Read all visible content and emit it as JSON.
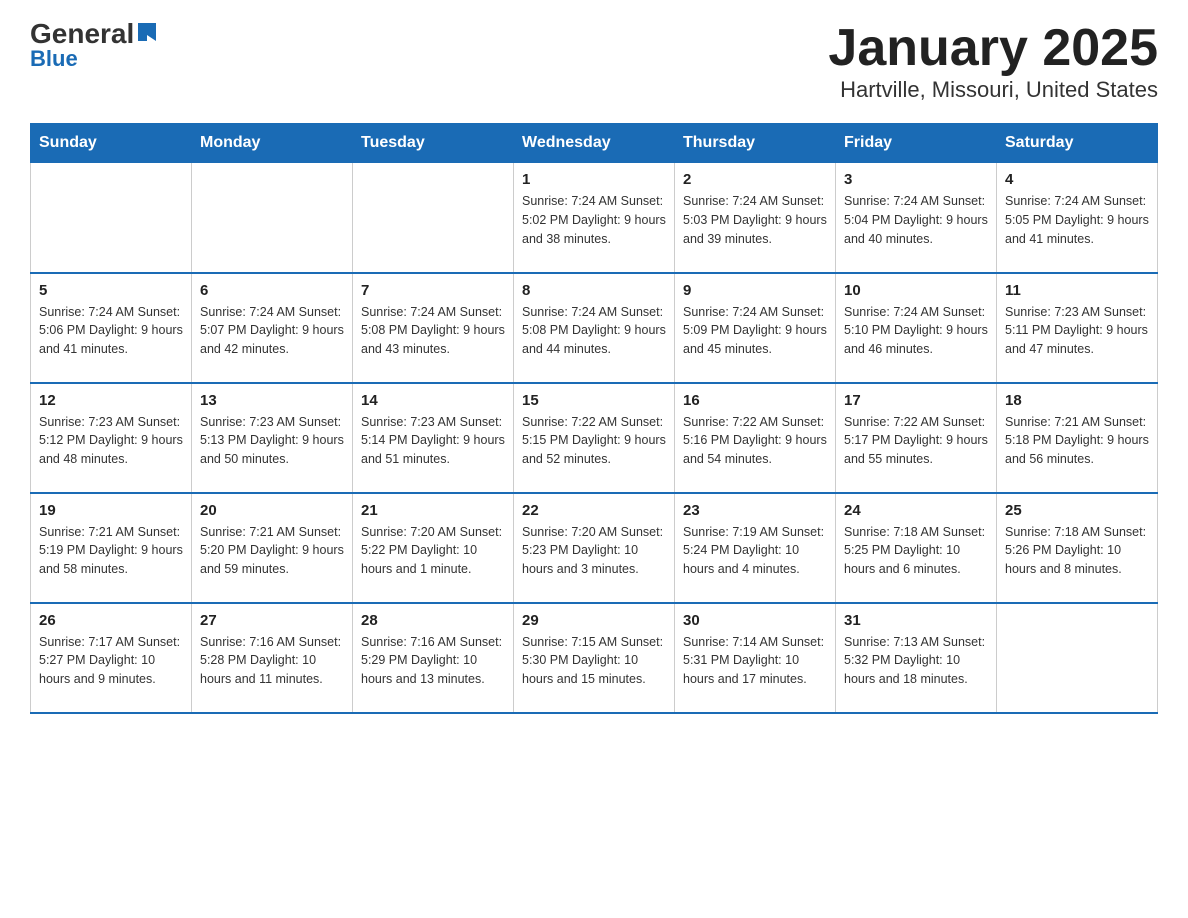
{
  "logo": {
    "general": "General",
    "blue": "Blue",
    "arrow": "▼"
  },
  "title": "January 2025",
  "subtitle": "Hartville, Missouri, United States",
  "days_of_week": [
    "Sunday",
    "Monday",
    "Tuesday",
    "Wednesday",
    "Thursday",
    "Friday",
    "Saturday"
  ],
  "weeks": [
    [
      {
        "day": "",
        "info": ""
      },
      {
        "day": "",
        "info": ""
      },
      {
        "day": "",
        "info": ""
      },
      {
        "day": "1",
        "info": "Sunrise: 7:24 AM\nSunset: 5:02 PM\nDaylight: 9 hours\nand 38 minutes."
      },
      {
        "day": "2",
        "info": "Sunrise: 7:24 AM\nSunset: 5:03 PM\nDaylight: 9 hours\nand 39 minutes."
      },
      {
        "day": "3",
        "info": "Sunrise: 7:24 AM\nSunset: 5:04 PM\nDaylight: 9 hours\nand 40 minutes."
      },
      {
        "day": "4",
        "info": "Sunrise: 7:24 AM\nSunset: 5:05 PM\nDaylight: 9 hours\nand 41 minutes."
      }
    ],
    [
      {
        "day": "5",
        "info": "Sunrise: 7:24 AM\nSunset: 5:06 PM\nDaylight: 9 hours\nand 41 minutes."
      },
      {
        "day": "6",
        "info": "Sunrise: 7:24 AM\nSunset: 5:07 PM\nDaylight: 9 hours\nand 42 minutes."
      },
      {
        "day": "7",
        "info": "Sunrise: 7:24 AM\nSunset: 5:08 PM\nDaylight: 9 hours\nand 43 minutes."
      },
      {
        "day": "8",
        "info": "Sunrise: 7:24 AM\nSunset: 5:08 PM\nDaylight: 9 hours\nand 44 minutes."
      },
      {
        "day": "9",
        "info": "Sunrise: 7:24 AM\nSunset: 5:09 PM\nDaylight: 9 hours\nand 45 minutes."
      },
      {
        "day": "10",
        "info": "Sunrise: 7:24 AM\nSunset: 5:10 PM\nDaylight: 9 hours\nand 46 minutes."
      },
      {
        "day": "11",
        "info": "Sunrise: 7:23 AM\nSunset: 5:11 PM\nDaylight: 9 hours\nand 47 minutes."
      }
    ],
    [
      {
        "day": "12",
        "info": "Sunrise: 7:23 AM\nSunset: 5:12 PM\nDaylight: 9 hours\nand 48 minutes."
      },
      {
        "day": "13",
        "info": "Sunrise: 7:23 AM\nSunset: 5:13 PM\nDaylight: 9 hours\nand 50 minutes."
      },
      {
        "day": "14",
        "info": "Sunrise: 7:23 AM\nSunset: 5:14 PM\nDaylight: 9 hours\nand 51 minutes."
      },
      {
        "day": "15",
        "info": "Sunrise: 7:22 AM\nSunset: 5:15 PM\nDaylight: 9 hours\nand 52 minutes."
      },
      {
        "day": "16",
        "info": "Sunrise: 7:22 AM\nSunset: 5:16 PM\nDaylight: 9 hours\nand 54 minutes."
      },
      {
        "day": "17",
        "info": "Sunrise: 7:22 AM\nSunset: 5:17 PM\nDaylight: 9 hours\nand 55 minutes."
      },
      {
        "day": "18",
        "info": "Sunrise: 7:21 AM\nSunset: 5:18 PM\nDaylight: 9 hours\nand 56 minutes."
      }
    ],
    [
      {
        "day": "19",
        "info": "Sunrise: 7:21 AM\nSunset: 5:19 PM\nDaylight: 9 hours\nand 58 minutes."
      },
      {
        "day": "20",
        "info": "Sunrise: 7:21 AM\nSunset: 5:20 PM\nDaylight: 9 hours\nand 59 minutes."
      },
      {
        "day": "21",
        "info": "Sunrise: 7:20 AM\nSunset: 5:22 PM\nDaylight: 10 hours\nand 1 minute."
      },
      {
        "day": "22",
        "info": "Sunrise: 7:20 AM\nSunset: 5:23 PM\nDaylight: 10 hours\nand 3 minutes."
      },
      {
        "day": "23",
        "info": "Sunrise: 7:19 AM\nSunset: 5:24 PM\nDaylight: 10 hours\nand 4 minutes."
      },
      {
        "day": "24",
        "info": "Sunrise: 7:18 AM\nSunset: 5:25 PM\nDaylight: 10 hours\nand 6 minutes."
      },
      {
        "day": "25",
        "info": "Sunrise: 7:18 AM\nSunset: 5:26 PM\nDaylight: 10 hours\nand 8 minutes."
      }
    ],
    [
      {
        "day": "26",
        "info": "Sunrise: 7:17 AM\nSunset: 5:27 PM\nDaylight: 10 hours\nand 9 minutes."
      },
      {
        "day": "27",
        "info": "Sunrise: 7:16 AM\nSunset: 5:28 PM\nDaylight: 10 hours\nand 11 minutes."
      },
      {
        "day": "28",
        "info": "Sunrise: 7:16 AM\nSunset: 5:29 PM\nDaylight: 10 hours\nand 13 minutes."
      },
      {
        "day": "29",
        "info": "Sunrise: 7:15 AM\nSunset: 5:30 PM\nDaylight: 10 hours\nand 15 minutes."
      },
      {
        "day": "30",
        "info": "Sunrise: 7:14 AM\nSunset: 5:31 PM\nDaylight: 10 hours\nand 17 minutes."
      },
      {
        "day": "31",
        "info": "Sunrise: 7:13 AM\nSunset: 5:32 PM\nDaylight: 10 hours\nand 18 minutes."
      },
      {
        "day": "",
        "info": ""
      }
    ]
  ]
}
